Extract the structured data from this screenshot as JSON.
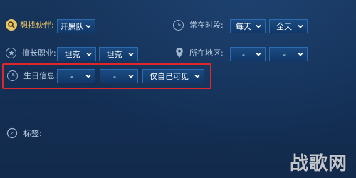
{
  "fields": {
    "partner": {
      "label": "想找伙伴:",
      "value": "开黑队"
    },
    "online_time": {
      "label": "常在时段:",
      "day": "每天",
      "period": "全天"
    },
    "role": {
      "label": "擅长职业:",
      "primary": "坦克",
      "secondary": "坦克"
    },
    "region": {
      "label": "所在地区:",
      "province": "-",
      "city": "-"
    },
    "birthday": {
      "label": "生日信息:",
      "month": "-",
      "day": "-",
      "visibility": "仅自己可见"
    },
    "tags": {
      "label": "标签:"
    }
  },
  "watermark": "战歌网",
  "colors": {
    "highlight": "#e0262b",
    "gold_label": "#e9c56a"
  }
}
